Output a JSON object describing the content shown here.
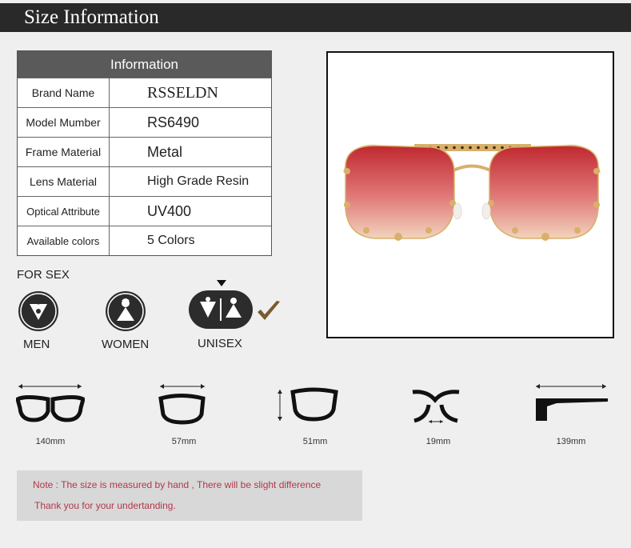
{
  "header": {
    "title": "Size Information"
  },
  "info": {
    "title": "Information",
    "rows": [
      {
        "label": "Brand Name",
        "value": "RSSELDN"
      },
      {
        "label": "Model Mumber",
        "value": "RS6490"
      },
      {
        "label": "Frame Material",
        "value": "Metal"
      },
      {
        "label": "Lens Material",
        "value": "High Grade Resin"
      },
      {
        "label": "Optical Attribute",
        "value": "UV400"
      },
      {
        "label": "Available colors",
        "value": "5 Colors"
      }
    ]
  },
  "sex": {
    "heading": "FOR SEX",
    "options": [
      {
        "label": "MEN",
        "selected": false
      },
      {
        "label": "WOMEN",
        "selected": false
      },
      {
        "label": "UNISEX",
        "selected": true
      }
    ],
    "check_color": "#7a5a2e"
  },
  "measurements": [
    {
      "value": "140mm"
    },
    {
      "value": "57mm"
    },
    {
      "value": "51mm"
    },
    {
      "value": "19mm"
    },
    {
      "value": "139mm"
    }
  ],
  "note": {
    "line1": "Note : The size is measured by hand , There will be slight difference",
    "line2": "Thank you for your undertanding."
  },
  "colors": {
    "header_bg": "#292929",
    "table_title_bg": "#5a5a5a",
    "note_text": "#b2374a",
    "lens_top": "#c0282f",
    "lens_bottom": "#f0c9b4",
    "frame_gold": "#d8b06a"
  }
}
